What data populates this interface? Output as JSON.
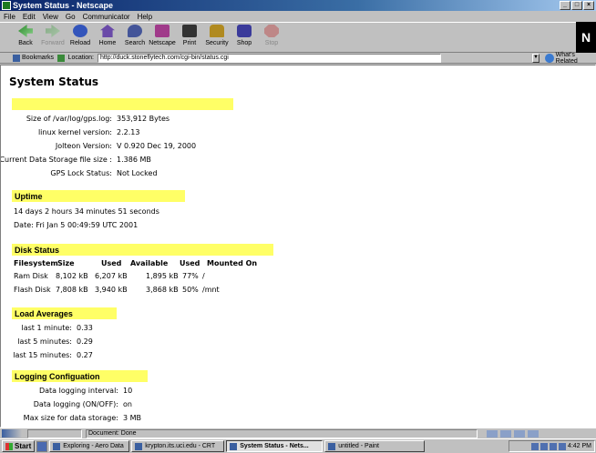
{
  "window": {
    "title": "System Status - Netscape",
    "controls": [
      "_",
      "□",
      "×"
    ]
  },
  "menu": [
    "File",
    "Edit",
    "View",
    "Go",
    "Communicator",
    "Help"
  ],
  "toolbar": [
    {
      "label": "Back",
      "icon": "back-arrow-icon",
      "enabled": true
    },
    {
      "label": "Forward",
      "icon": "forward-arrow-icon",
      "enabled": false
    },
    {
      "label": "Reload",
      "icon": "reload-icon",
      "enabled": true
    },
    {
      "label": "Home",
      "icon": "home-icon",
      "enabled": true
    },
    {
      "label": "Search",
      "icon": "search-icon",
      "enabled": true
    },
    {
      "label": "Netscape",
      "icon": "netscape-icon",
      "enabled": true
    },
    {
      "label": "Print",
      "icon": "print-icon",
      "enabled": true
    },
    {
      "label": "Security",
      "icon": "security-lock-icon",
      "enabled": true
    },
    {
      "label": "Shop",
      "icon": "shop-icon",
      "enabled": true
    },
    {
      "label": "Stop",
      "icon": "stop-icon",
      "enabled": false
    }
  ],
  "location": {
    "bookmarks_label": "Bookmarks",
    "location_label": "Location:",
    "url": "http://duck.stoneflytech.com/cgi-bin/status.cgi",
    "related_label": "What's Related"
  },
  "page": {
    "title": "System Status",
    "system": {
      "rows": [
        {
          "label": "Size of /var/log/gps.log:",
          "value": "353,912 Bytes"
        },
        {
          "label": "linux kernel version:",
          "value": "2.2.13"
        },
        {
          "label": "Jolteon Version:",
          "value": "V 0.920 Dec 19, 2000"
        },
        {
          "label": "Current Data Storage file size :",
          "value": "1.386 MB"
        },
        {
          "label": "GPS Lock Status:",
          "value": "Not Locked"
        }
      ]
    },
    "uptime": {
      "title": "Uptime",
      "line1": "14 days  2 hours  34 minutes  51 seconds",
      "line2": "Date: Fri Jan 5 00:49:59 UTC 2001"
    },
    "disk": {
      "title": "Disk Status",
      "headers": [
        "Filesystem",
        "Size",
        "Used",
        "Available",
        "Used",
        "Mounted On"
      ],
      "rows": [
        [
          "Ram Disk",
          "8,102 kB",
          "6,207 kB",
          "1,895 kB",
          "77%",
          "/"
        ],
        [
          "Flash Disk",
          "7,808 kB",
          "3,940 kB",
          "3,868 kB",
          "50%",
          "/mnt"
        ]
      ]
    },
    "load": {
      "title": "Load Averages",
      "rows": [
        {
          "label": "last 1 minute:",
          "value": "0.33"
        },
        {
          "label": "last 5 minutes:",
          "value": "0.29"
        },
        {
          "label": "last 15 minutes:",
          "value": "0.27"
        }
      ]
    },
    "logging": {
      "title": "Logging Configuation",
      "rows": [
        {
          "label": "Data logging interval:",
          "value": "10"
        },
        {
          "label": "Data logging (ON/OFF):",
          "value": "on"
        },
        {
          "label": "Max size for data storage:",
          "value": "3 MB"
        }
      ]
    }
  },
  "status": {
    "text": "Document: Done"
  },
  "taskbar": {
    "start_label": "Start",
    "tasks": [
      {
        "label": "Exploring - Aero Data",
        "active": false
      },
      {
        "label": "krypton.its.uci.edu - CRT",
        "active": false
      },
      {
        "label": "System Status - Nets...",
        "active": true
      },
      {
        "label": "untitled - Paint",
        "active": false
      }
    ],
    "clock": "4:42 PM"
  },
  "colors": {
    "highlight": "#ffff66",
    "title_bar": "#0a246a",
    "content_bg": "#ffffff"
  }
}
